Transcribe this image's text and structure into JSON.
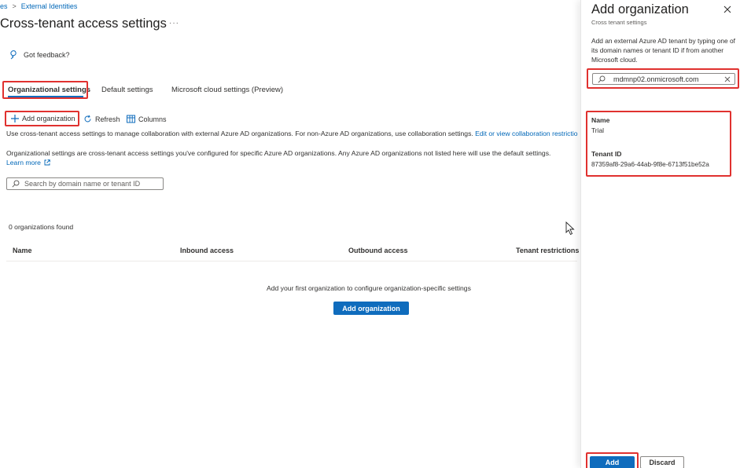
{
  "breadcrumb": {
    "prev": "es",
    "current": "External Identities"
  },
  "page": {
    "title": "Cross-tenant access settings",
    "more": "···"
  },
  "feedback": {
    "label": "Got feedback?"
  },
  "tabs": [
    {
      "label": "Organizational settings"
    },
    {
      "label": "Default settings"
    },
    {
      "label": "Microsoft cloud settings (Preview)"
    }
  ],
  "toolbar": {
    "add": "Add organization",
    "refresh": "Refresh",
    "columns": "Columns"
  },
  "desc": {
    "line1": "Use cross-tenant access settings to manage collaboration with external Azure AD organizations. For non-Azure AD organizations, use collaboration settings.",
    "line1_link": "Edit or view collaboration restrictio",
    "line2": "Organizational settings are cross-tenant access settings you've configured for specific Azure AD organizations. Any Azure AD organizations not listed here will use the default settings.",
    "learn_more": "Learn more"
  },
  "search": {
    "placeholder": "Search by domain name or tenant ID"
  },
  "results": {
    "count_text": "0 organizations found"
  },
  "table": {
    "columns": [
      "Name",
      "Inbound access",
      "Outbound access",
      "Tenant restrictions"
    ]
  },
  "empty": {
    "message": "Add your first organization to configure organization-specific settings",
    "button": "Add organization"
  },
  "panel": {
    "title": "Add organization",
    "subtitle": "Cross tenant settings",
    "instructions": "Add an external Azure AD tenant by typing one of its domain names or tenant ID if from another Microsoft cloud.",
    "search_value": "mdmnp02.onmicrosoft.com",
    "name_label": "Name",
    "name_value": "Trial",
    "tenant_label": "Tenant ID",
    "tenant_value": "87359af8-29a6-44ab-9f8e-6713f51be52a",
    "add_button": "Add",
    "discard_button": "Discard"
  },
  "colors": {
    "accent": "#0f6cbd",
    "highlight": "#e0312f",
    "link": "#0067b8"
  }
}
